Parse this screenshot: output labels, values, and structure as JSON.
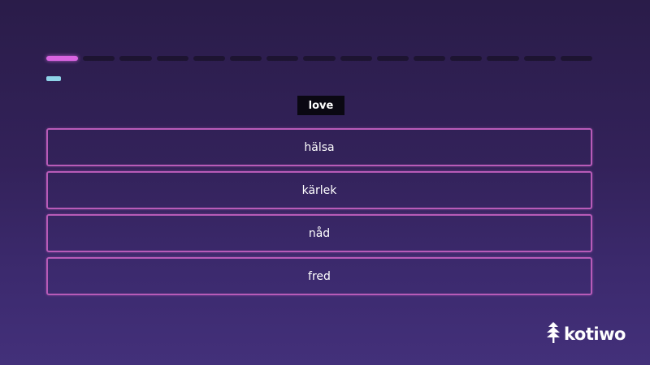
{
  "progress": {
    "segments_total": 15,
    "segments_done": 1
  },
  "lives": {
    "count": 1
  },
  "question": {
    "prompt": "love"
  },
  "options": [
    {
      "label": "hälsa"
    },
    {
      "label": "kärlek"
    },
    {
      "label": "nåd"
    },
    {
      "label": "fred"
    }
  ],
  "brand": {
    "name": "kotiwo",
    "icon": "tree-icon"
  },
  "colors": {
    "accent": "#d864e0",
    "option_border": "#b85bb8",
    "life": "#8fd3e8",
    "prompt_bg": "#0a0812"
  }
}
